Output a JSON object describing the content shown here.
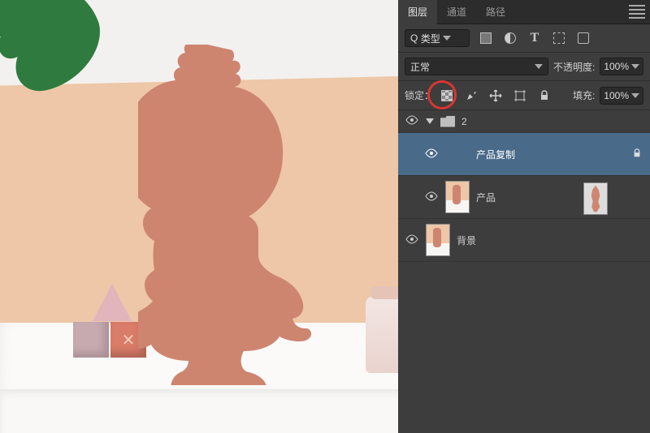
{
  "tabs": {
    "layers": "图层",
    "channels": "通道",
    "paths": "路径"
  },
  "filter": {
    "search_prefix": "Q",
    "mode": "类型"
  },
  "blend": {
    "mode": "正常",
    "opacity_label": "不透明度:",
    "opacity_value": "100%"
  },
  "lock": {
    "label": "锁定：",
    "fill_label": "填充:",
    "fill_value": "100%"
  },
  "group": {
    "name": "2"
  },
  "layers": [
    {
      "name": "产品复制",
      "locked": true
    },
    {
      "name": "产品",
      "locked": false
    },
    {
      "name": "背景",
      "locked": false
    }
  ]
}
